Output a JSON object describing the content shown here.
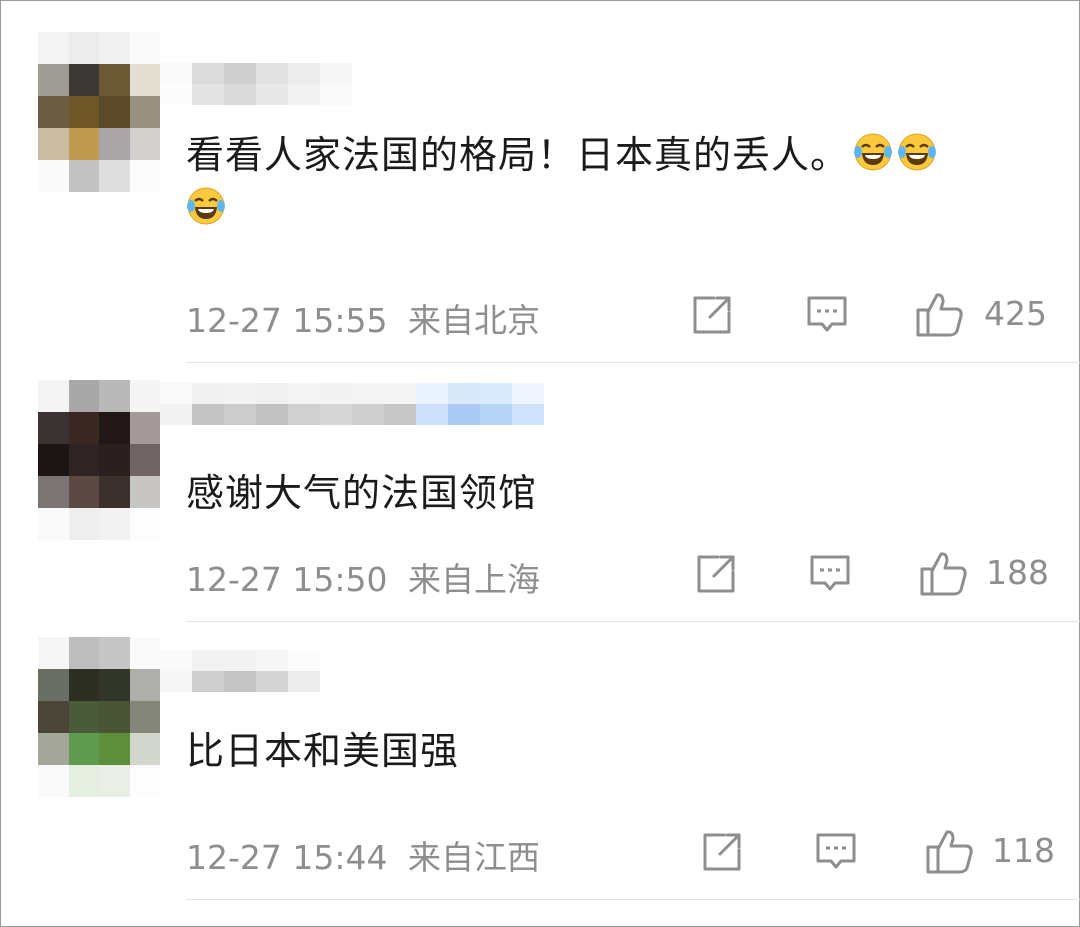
{
  "comments": [
    {
      "text": "看看人家法国的格局！日本真的丢人。",
      "emoji": "laughing-tears-emoji",
      "time": "12-27 15:55",
      "location": "来自北京",
      "likes": "425"
    },
    {
      "text": "感谢大气的法国领馆",
      "time": "12-27 15:50",
      "location": "来自上海",
      "likes": "188"
    },
    {
      "text": "比日本和美国强",
      "time": "12-27 15:44",
      "location": "来自江西",
      "likes": "118"
    }
  ],
  "icons": {
    "share": "share-icon",
    "comment": "comment-icon",
    "like": "thumbs-up-icon"
  },
  "colors": {
    "text": "#1b1b1b",
    "meta": "#8e8e8e",
    "icon": "#8e8e8e",
    "divider": "#e4e4e4"
  }
}
